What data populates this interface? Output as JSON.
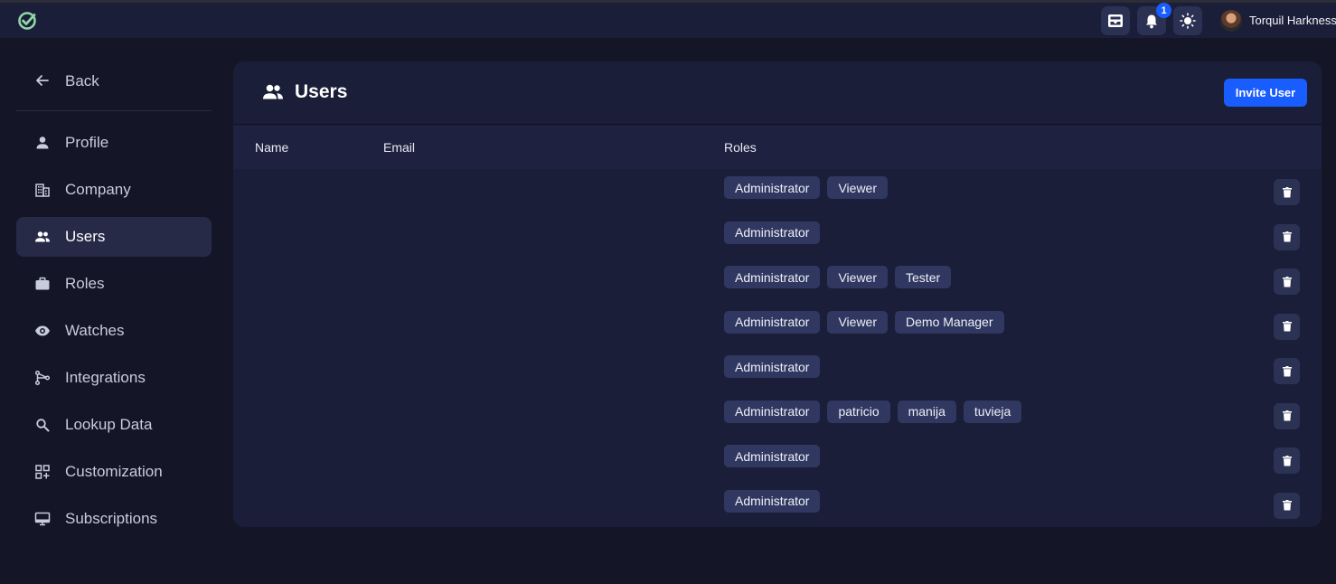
{
  "header": {
    "user_name": "Torquil Harkness",
    "notification_count": "1",
    "icons": [
      "logo-check-icon",
      "inbox-icon",
      "bell-icon",
      "sun-icon"
    ]
  },
  "sidebar": {
    "back_label": "Back",
    "items": [
      {
        "label": "Profile",
        "icon": "person-icon",
        "active": false
      },
      {
        "label": "Company",
        "icon": "building-icon",
        "active": false
      },
      {
        "label": "Users",
        "icon": "users-icon",
        "active": true
      },
      {
        "label": "Roles",
        "icon": "briefcase-icon",
        "active": false
      },
      {
        "label": "Watches",
        "icon": "eye-icon",
        "active": false
      },
      {
        "label": "Integrations",
        "icon": "integrations-icon",
        "active": false
      },
      {
        "label": "Lookup Data",
        "icon": "search-icon",
        "active": false
      },
      {
        "label": "Customization",
        "icon": "grid-plus-icon",
        "active": false
      },
      {
        "label": "Subscriptions",
        "icon": "monitor-icon",
        "active": false
      }
    ]
  },
  "main": {
    "title": "Users",
    "invite_label": "Invite User",
    "columns": {
      "name": "Name",
      "email": "Email",
      "roles": "Roles"
    },
    "rows": [
      {
        "roles": [
          "Administrator",
          "Viewer"
        ]
      },
      {
        "roles": [
          "Administrator"
        ]
      },
      {
        "roles": [
          "Administrator",
          "Viewer",
          "Tester"
        ]
      },
      {
        "roles": [
          "Administrator",
          "Viewer",
          "Demo Manager"
        ]
      },
      {
        "roles": [
          "Administrator"
        ]
      },
      {
        "roles": [
          "Administrator",
          "patricio",
          "manija",
          "tuvieja"
        ]
      },
      {
        "roles": [
          "Administrator"
        ]
      },
      {
        "roles": [
          "Administrator"
        ]
      }
    ]
  },
  "colors": {
    "background": "#141526",
    "surface": "#1b1e38",
    "accent": "#1a5dff",
    "chip": "#303861"
  }
}
